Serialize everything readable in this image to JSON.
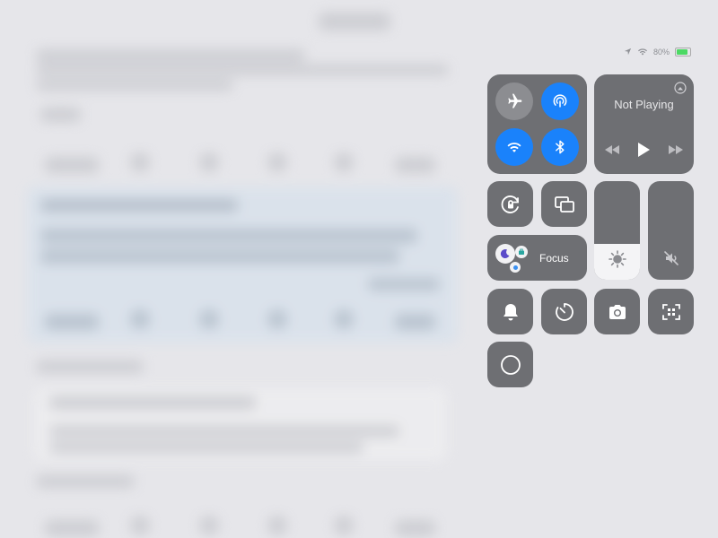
{
  "status": {
    "battery": "80%"
  },
  "media": {
    "now_playing": "Not Playing"
  },
  "focus": {
    "label": "Focus"
  },
  "sliders": {
    "brightness_level": 0.36,
    "volume_level": 0.0
  },
  "colors": {
    "active_blue": "#1a82fb",
    "tile_gray": "#6e6f73",
    "inactive_gray": "#8c8d91"
  }
}
